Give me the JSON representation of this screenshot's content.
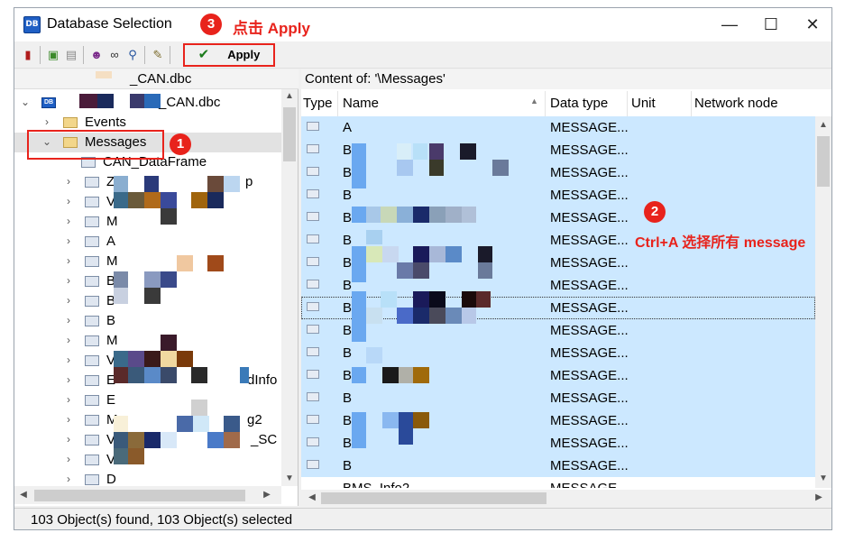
{
  "window": {
    "title": "Database Selection",
    "minimize": "—",
    "maximize": "☐",
    "close": "✕"
  },
  "annotations": {
    "step1": "1",
    "step2": "2",
    "step2_text": "Ctrl+A 选择所有 message",
    "step3": "3",
    "step3_text": "点击 Apply"
  },
  "toolbar": {
    "apply_label": "Apply",
    "icons": [
      "exit-icon",
      "open-icon",
      "save-icon",
      "agent-icon",
      "binoculars-icon",
      "search-icon",
      "properties-icon"
    ]
  },
  "left_panel": {
    "header": "_CAN.dbc",
    "tree": [
      {
        "label": "_CAN.dbc",
        "arrow": "⌄"
      },
      {
        "label": "Events",
        "arrow": "›"
      },
      {
        "label": "Messages",
        "arrow": "⌄"
      },
      {
        "label": "CAN_DataFrame",
        "arrow": ""
      },
      {
        "label": "Z",
        "suffix": "p",
        "arrow": "›"
      },
      {
        "label": "V",
        "arrow": "›"
      },
      {
        "label": "M",
        "arrow": "›"
      },
      {
        "label": "A",
        "arrow": "›"
      },
      {
        "label": "M",
        "arrow": "›"
      },
      {
        "label": "B",
        "arrow": "›"
      },
      {
        "label": "B",
        "arrow": "›"
      },
      {
        "label": "B",
        "arrow": "›"
      },
      {
        "label": "M",
        "arrow": "›"
      },
      {
        "label": "V",
        "arrow": "›"
      },
      {
        "label": "E",
        "suffix": "dInfo",
        "arrow": "›"
      },
      {
        "label": "E",
        "arrow": "›"
      },
      {
        "label": "M",
        "suffix": "g2",
        "arrow": "›"
      },
      {
        "label": "V",
        "suffix": "_SC",
        "arrow": "›"
      },
      {
        "label": "V",
        "arrow": "›"
      },
      {
        "label": "D",
        "arrow": "›"
      }
    ]
  },
  "right_panel": {
    "header": "Content of: '\\Messages'",
    "columns": [
      "Type",
      "Name",
      "Data type",
      "Unit",
      "Network node"
    ],
    "rows": [
      {
        "name": "A",
        "data_type": "MESSAGE..."
      },
      {
        "name": "B",
        "data_type": "MESSAGE..."
      },
      {
        "name": "B",
        "data_type": "MESSAGE..."
      },
      {
        "name": "B",
        "data_type": "MESSAGE..."
      },
      {
        "name": "B",
        "data_type": "MESSAGE..."
      },
      {
        "name": "B",
        "data_type": "MESSAGE..."
      },
      {
        "name": "B",
        "data_type": "MESSAGE..."
      },
      {
        "name": "B",
        "data_type": "MESSAGE..."
      },
      {
        "name": "B",
        "data_type": "MESSAGE..."
      },
      {
        "name": "B",
        "data_type": "MESSAGE..."
      },
      {
        "name": "B",
        "data_type": "MESSAGE..."
      },
      {
        "name": "B",
        "data_type": "MESSAGE..."
      },
      {
        "name": "B",
        "data_type": "MESSAGE..."
      },
      {
        "name": "B",
        "data_type": "MESSAGE..."
      },
      {
        "name": "B",
        "data_type": "MESSAGE..."
      },
      {
        "name": "B",
        "data_type": "MESSAGE..."
      }
    ],
    "partial_row": {
      "name": "BMS_Info2",
      "data_type": "MESSAGE"
    }
  },
  "status": {
    "text": "103 Object(s) found,   103 Object(s) selected"
  },
  "colors": {
    "selection": "#cce8ff",
    "annotation": "#e8231c"
  }
}
